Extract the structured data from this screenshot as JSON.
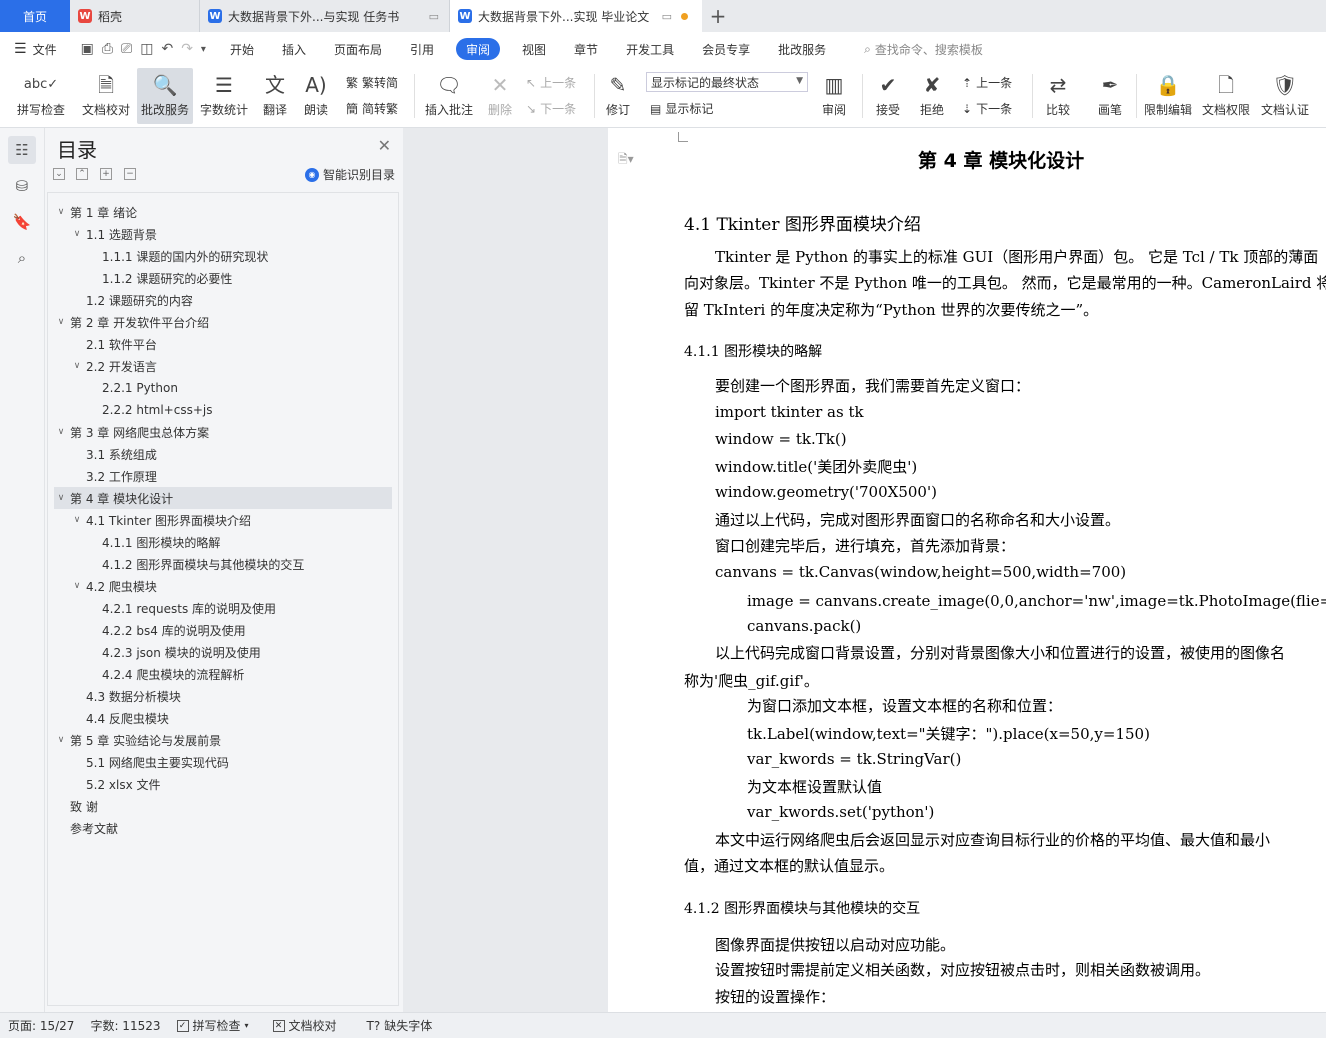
{
  "tabs": [
    {
      "label": "首页"
    },
    {
      "label": "稻壳"
    },
    {
      "label": "大数据背景下外...与实现 任务书"
    },
    {
      "label": "大数据背景下外...实现 毕业论文"
    }
  ],
  "menu": {
    "file": "文件",
    "items": [
      "开始",
      "插入",
      "页面布局",
      "引用",
      "审阅",
      "视图",
      "章节",
      "开发工具",
      "会员专享",
      "批改服务"
    ],
    "search_placeholder": "查找命令、搜索模板"
  },
  "ribbon": {
    "spell": "拼写检查",
    "proof": "文档校对",
    "correction": "批改服务",
    "wordcount": "字数统计",
    "translate": "翻译",
    "read": "朗读",
    "trad": "繁转简",
    "simp": "简转繁",
    "insert_comment": "插入批注",
    "delete": "删除",
    "prev": "上一条",
    "next": "下一条",
    "revise": "修订",
    "markup_combo": "显示标记的最终状态",
    "show_markup": "显示标记",
    "review": "审阅",
    "accept": "接受",
    "reject": "拒绝",
    "prev2": "上一条",
    "next2": "下一条",
    "compare": "比较",
    "pen": "画笔",
    "restrict": "限制编辑",
    "perm": "文档权限",
    "cert": "文档认证"
  },
  "toc": {
    "title": "目录",
    "smart": "智能识别目录",
    "items": [
      {
        "text": "第 1 章 绪论",
        "level": 0,
        "caret": "v"
      },
      {
        "text": "1.1 选题背景",
        "level": 1,
        "caret": "v"
      },
      {
        "text": "1.1.1 课题的国内外的研究现状",
        "level": 2,
        "caret": ""
      },
      {
        "text": "1.1.2 课题研究的必要性",
        "level": 2,
        "caret": ""
      },
      {
        "text": "1.2 课题研究的内容",
        "level": 1,
        "caret": ""
      },
      {
        "text": "第 2 章 开发软件平台介绍",
        "level": 0,
        "caret": "v"
      },
      {
        "text": "2.1    软件平台",
        "level": 1,
        "caret": ""
      },
      {
        "text": "2.2    开发语言",
        "level": 1,
        "caret": "v"
      },
      {
        "text": "2.2.1 Python",
        "level": 2,
        "caret": ""
      },
      {
        "text": "2.2.2 html+css+js",
        "level": 2,
        "caret": ""
      },
      {
        "text": "第 3 章 网络爬虫总体方案",
        "level": 0,
        "caret": "v"
      },
      {
        "text": "3.1    系统组成",
        "level": 1,
        "caret": ""
      },
      {
        "text": "3.2    工作原理",
        "level": 1,
        "caret": ""
      },
      {
        "text": "第 4 章 模块化设计",
        "level": 0,
        "caret": "v"
      },
      {
        "text": "4.1    Tkinter 图形界面模块介绍",
        "level": 1,
        "caret": "v"
      },
      {
        "text": "4.1.1 图形模块的略解",
        "level": 2,
        "caret": ""
      },
      {
        "text": "4.1.2 图形界面模块与其他模块的交互",
        "level": 2,
        "caret": ""
      },
      {
        "text": "4.2    爬虫模块",
        "level": 1,
        "caret": "v"
      },
      {
        "text": "4.2.1 requests 库的说明及使用",
        "level": 2,
        "caret": ""
      },
      {
        "text": "4.2.2 bs4 库的说明及使用",
        "level": 2,
        "caret": ""
      },
      {
        "text": "4.2.3 json 模块的说明及使用",
        "level": 2,
        "caret": ""
      },
      {
        "text": "4.2.4 爬虫模块的流程解析",
        "level": 2,
        "caret": ""
      },
      {
        "text": "4.3    数据分析模块",
        "level": 1,
        "caret": ""
      },
      {
        "text": "4.4    反爬虫模块",
        "level": 1,
        "caret": ""
      },
      {
        "text": "第 5 章 实验结论与发展前景",
        "level": 0,
        "caret": "v"
      },
      {
        "text": "5.1 网络爬虫主要实现代码",
        "level": 1,
        "caret": ""
      },
      {
        "text": "5.2 xlsx 文件",
        "level": 1,
        "caret": ""
      },
      {
        "text": "致  谢",
        "level": 0,
        "caret": ""
      },
      {
        "text": "参考文献",
        "level": 0,
        "caret": ""
      }
    ],
    "selected_index": 13
  },
  "doc": {
    "chapter_title": "第 4 章 模块化设计",
    "lines": [
      {
        "text": "4.1   Tkinter 图形界面模块介绍",
        "cls": "h2"
      },
      {
        "text": "Tkinter 是 Python 的事实上的标准 GUI（图形用户界面）包。 它是 Tcl / Tk 顶部的薄面",
        "cls": "p"
      },
      {
        "text": "向对象层。Tkinter 不是 Python 唯一的工具包。 然而，它是最常用的一种。CameronLaird 将保",
        "cls": "p"
      },
      {
        "text": "留 TkInteri 的年度决定称为“Python 世界的次要传统之一”。",
        "cls": "p"
      },
      {
        "text": "4.1.1 图形模块的略解",
        "cls": "h3"
      },
      {
        "text": "要创建一个图形界面，我们需要首先定义窗口：",
        "cls": "p"
      },
      {
        "text": "import tkinter as tk",
        "cls": "p"
      },
      {
        "text": "window = tk.Tk()",
        "cls": "p"
      },
      {
        "text": "window.title('美团外卖爬虫')",
        "cls": "p"
      },
      {
        "text": "window.geometry('700X500')",
        "cls": "p"
      },
      {
        "text": "通过以上代码，完成对图形界面窗口的名称命名和大小设置。",
        "cls": "p"
      },
      {
        "text": "窗口创建完毕后，进行填充，首先添加背景：",
        "cls": "p"
      },
      {
        "text": "canvans = tk.Canvas(window,height=500,width=700)",
        "cls": "p"
      },
      {
        "text": "image = canvans.create_image(0,0,anchor='nw',image=tk.PhotoImage(flie='爬虫_gif.gif')",
        "cls": "p"
      },
      {
        "text": "canvans.pack()",
        "cls": "p"
      },
      {
        "text": "以上代码完成窗口背景设置，分别对背景图像大小和位置进行的设置，被使用的图像名",
        "cls": "p"
      },
      {
        "text": "称为'爬虫_gif.gif'。",
        "cls": "p"
      },
      {
        "text": "为窗口添加文本框，设置文本框的名称和位置：",
        "cls": "p"
      },
      {
        "text": "tk.Label(window,text=\"关键字：\").place(x=50,y=150)",
        "cls": "p"
      },
      {
        "text": "var_kwords = tk.StringVar()",
        "cls": "p"
      },
      {
        "text": "为文本框设置默认值",
        "cls": "p"
      },
      {
        "text": "var_kwords.set('python')",
        "cls": "p"
      },
      {
        "text": "本文中运行网络爬虫后会返回显示对应查询目标行业的价格的平均值、最大值和最小",
        "cls": "p"
      },
      {
        "text": "值，通过文本框的默认值显示。",
        "cls": "p"
      },
      {
        "text": "4.1.2 图形界面模块与其他模块的交互",
        "cls": "h3"
      },
      {
        "text": "图像界面提供按钮以启动对应功能。",
        "cls": "p"
      },
      {
        "text": "设置按钮时需提前定义相关函数，对应按钮被点击时，则相关函数被调用。",
        "cls": "p"
      },
      {
        "text": "按钮的设置操作：",
        "cls": "p"
      }
    ]
  },
  "status": {
    "page": "页面: 15/27",
    "words": "字数: 11523",
    "spell": "拼写检查",
    "proof": "文档校对",
    "missing_font": "缺失字体"
  }
}
